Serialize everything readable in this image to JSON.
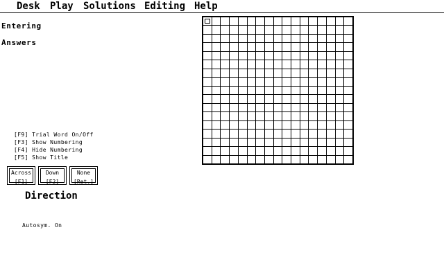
{
  "menubar": {
    "items": [
      "Desk",
      "Play",
      "Solutions",
      "Editing",
      "Help"
    ]
  },
  "mode": {
    "line1": "Entering",
    "line2": "Answers"
  },
  "function_keys": [
    "[F9] Trial Word On/Off",
    "[F3] Show Numbering",
    "[F4] Hide Numbering",
    "[F5] Show Title"
  ],
  "direction_buttons": [
    {
      "label": "Across",
      "key": "[F1]"
    },
    {
      "label": "Down",
      "key": "[F2]"
    },
    {
      "label": "None",
      "key": "[Ret.]"
    }
  ],
  "direction_label": "Direction",
  "autosym": "Autosym. On"
}
